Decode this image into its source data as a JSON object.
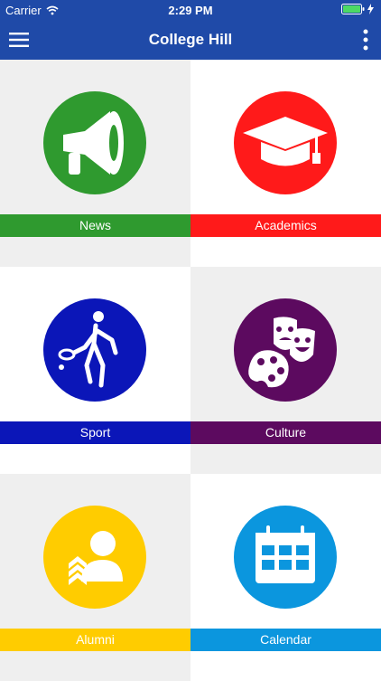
{
  "status_bar": {
    "carrier": "Carrier",
    "time": "2:29 PM"
  },
  "nav": {
    "title": "College Hill",
    "menu_icon": "hamburger-icon",
    "more_icon": "more-vertical-icon"
  },
  "colors": {
    "header": "#1f4aa8",
    "grey_bg": "#efefef",
    "white_bg": "#ffffff"
  },
  "tiles": [
    {
      "label": "News",
      "color": "#2f9a2f",
      "icon": "megaphone-icon"
    },
    {
      "label": "Academics",
      "color": "#ff1a1a",
      "icon": "graduation-cap-icon"
    },
    {
      "label": "Sport",
      "color": "#0b16b8",
      "icon": "tennis-player-icon"
    },
    {
      "label": "Culture",
      "color": "#5c0a5f",
      "icon": "theater-masks-palette-icon"
    },
    {
      "label": "Alumni",
      "color": "#ffcc00",
      "icon": "alumni-person-icon"
    },
    {
      "label": "Calendar",
      "color": "#0b96de",
      "icon": "calendar-icon"
    }
  ]
}
